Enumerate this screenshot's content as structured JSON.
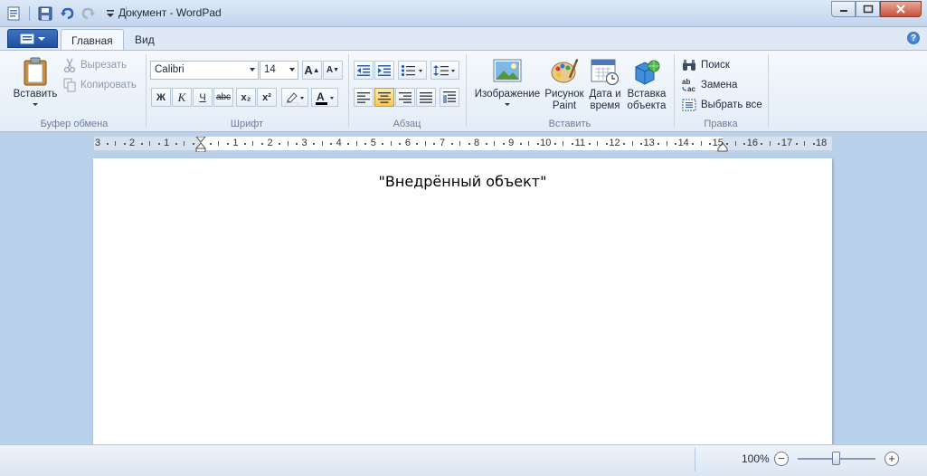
{
  "window": {
    "title": "Документ - WordPad"
  },
  "tabs": {
    "home": "Главная",
    "view": "Вид"
  },
  "clipboard": {
    "paste": "Вставить",
    "cut": "Вырезать",
    "copy": "Копировать",
    "group_label": "Буфер обмена"
  },
  "font": {
    "family": "Calibri",
    "size": "14",
    "group_label": "Шрифт",
    "bold": "Ж",
    "italic": "К",
    "underline": "Ч",
    "strike": "abc",
    "subscript": "x₂",
    "superscript": "x²",
    "grow": "A",
    "shrink": "A",
    "font_color_letter": "A"
  },
  "paragraph": {
    "group_label": "Абзац",
    "active_alignment": "center"
  },
  "insert": {
    "picture": "Изображение",
    "paint_line1": "Рисунок",
    "paint_line2": "Paint",
    "datetime_line1": "Дата и",
    "datetime_line2": "время",
    "object_line1": "Вставка",
    "object_line2": "объекта",
    "group_label": "Вставить"
  },
  "editing": {
    "find": "Поиск",
    "replace": "Замена",
    "select_all": "Выбрать все",
    "group_label": "Правка"
  },
  "ruler": {
    "labels": [
      "3",
      "2",
      "1",
      "1",
      "2",
      "3",
      "4",
      "5",
      "6",
      "7",
      "8",
      "9",
      "10",
      "11",
      "12",
      "13",
      "14",
      "15",
      "16",
      "17",
      "18"
    ]
  },
  "document": {
    "text": "\"Внедрённый объект\""
  },
  "status": {
    "zoom": "100%",
    "zoom_out": "−",
    "zoom_in": "+"
  },
  "colors": {
    "font_color_bar": "#000000",
    "highlight_bar": "#ffffff",
    "accent": "#2a5ca8"
  }
}
